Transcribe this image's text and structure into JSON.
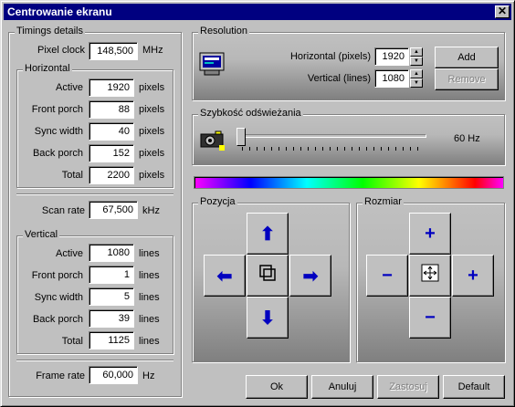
{
  "window": {
    "title": "Centrowanie ekranu",
    "close_label": "✕"
  },
  "timings": {
    "label": "Timings details",
    "pixel_clock": {
      "label": "Pixel clock",
      "value": "148,500",
      "unit": "MHz"
    },
    "horizontal": {
      "label": "Horizontal",
      "rows": [
        {
          "label": "Active",
          "value": "1920",
          "unit": "pixels"
        },
        {
          "label": "Front porch",
          "value": "88",
          "unit": "pixels"
        },
        {
          "label": "Sync width",
          "value": "40",
          "unit": "pixels"
        },
        {
          "label": "Back porch",
          "value": "152",
          "unit": "pixels"
        },
        {
          "label": "Total",
          "value": "2200",
          "unit": "pixels"
        }
      ],
      "scan_rate": {
        "label": "Scan rate",
        "value": "67,500",
        "unit": "kHz"
      }
    },
    "vertical": {
      "label": "Vertical",
      "rows": [
        {
          "label": "Active",
          "value": "1080",
          "unit": "lines"
        },
        {
          "label": "Front porch",
          "value": "1",
          "unit": "lines"
        },
        {
          "label": "Sync width",
          "value": "5",
          "unit": "lines"
        },
        {
          "label": "Back porch",
          "value": "39",
          "unit": "lines"
        },
        {
          "label": "Total",
          "value": "1125",
          "unit": "lines"
        }
      ],
      "frame_rate": {
        "label": "Frame rate",
        "value": "60,000",
        "unit": "Hz"
      }
    }
  },
  "resolution": {
    "label": "Resolution",
    "horizontal_label": "Horizontal (pixels)",
    "horizontal_value": "1920",
    "vertical_label": "Vertical (lines)",
    "vertical_value": "1080",
    "add_label": "Add",
    "remove_label": "Remove"
  },
  "refresh": {
    "label": "Szybkość odświeżania",
    "value_text": "60 Hz",
    "slider_level": 0.0
  },
  "position": {
    "label": "Pozycja"
  },
  "size": {
    "label": "Rozmiar"
  },
  "footer": {
    "ok": "Ok",
    "cancel": "Anuluj",
    "apply": "Zastosuj",
    "default": "Default"
  }
}
